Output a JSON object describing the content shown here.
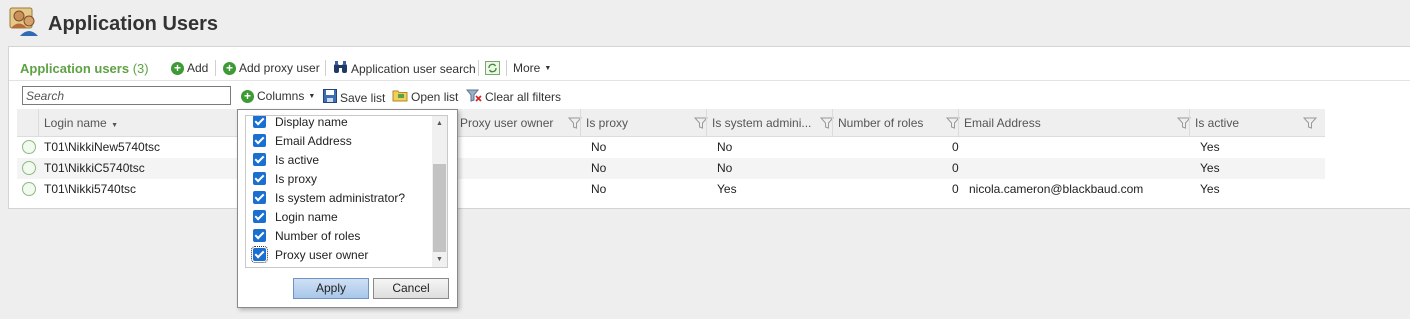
{
  "header": {
    "title": "Application Users",
    "icon": "users-icon"
  },
  "toolbar": {
    "panel_title": "Application users",
    "count": "(3)",
    "add_label": "Add",
    "add_proxy_label": "Add proxy user",
    "search_label": "Application user search",
    "more_label": "More"
  },
  "filters": {
    "search_placeholder": "Search",
    "columns_label": "Columns",
    "save_list_label": "Save list",
    "open_list_label": "Open list",
    "clear_filters_label": "Clear all filters"
  },
  "grid": {
    "columns": [
      "Login name",
      "Proxy user owner",
      "Is proxy",
      "Is system admini...",
      "Number of roles",
      "Email Address",
      "Is active"
    ],
    "rows": [
      {
        "login": "T01\\NikkiNew5740tsc",
        "is_proxy": "No",
        "is_admin": "No",
        "roles": "0",
        "email": "",
        "active": "Yes"
      },
      {
        "login": "T01\\NikkiC5740tsc",
        "is_proxy": "No",
        "is_admin": "No",
        "roles": "0",
        "email": "",
        "active": "Yes"
      },
      {
        "login": "T01\\Nikki5740tsc",
        "is_proxy": "No",
        "is_admin": "Yes",
        "roles": "0",
        "email": "nicola.cameron@blackbaud.com",
        "active": "Yes"
      }
    ]
  },
  "columns_popup": {
    "items": [
      "Display name",
      "Email Address",
      "Is active",
      "Is proxy",
      "Is system administrator?",
      "Login name",
      "Number of roles",
      "Proxy user owner"
    ],
    "apply_label": "Apply",
    "cancel_label": "Cancel"
  },
  "colors": {
    "accent": "#5ea244",
    "check": "#1a6fd1"
  }
}
